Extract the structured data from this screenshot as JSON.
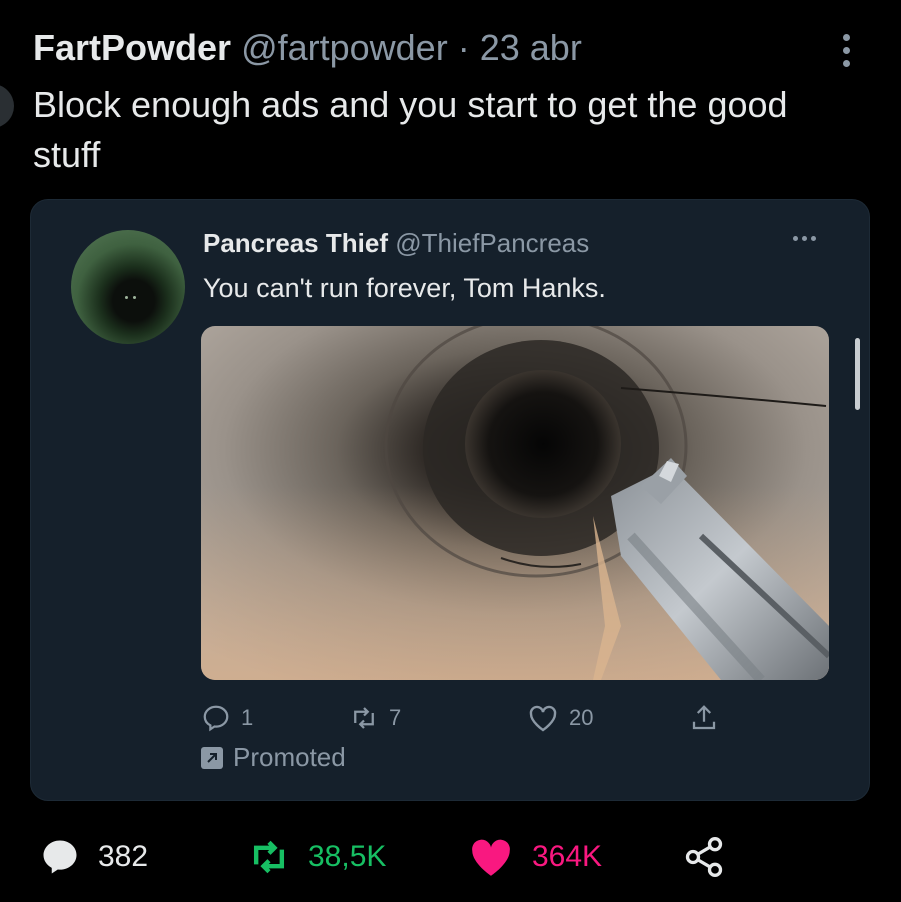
{
  "tweet": {
    "author_name": "FartPowder",
    "author_handle": "@fartpowder",
    "separator": "·",
    "date": "23 abr",
    "text": "Block enough ads and you start to get the good stuff",
    "stats": {
      "replies": "382",
      "retweets": "38,5K",
      "likes": "364K"
    }
  },
  "quoted": {
    "author_name": "Pancreas Thief",
    "author_handle": "@ThiefPancreas",
    "text": "You can't run forever, Tom Hanks.",
    "stats": {
      "replies": "1",
      "retweets": "7",
      "likes": "20"
    },
    "promoted_label": "Promoted"
  },
  "colors": {
    "background": "#000000",
    "card": "#15202b",
    "muted": "#8b98a5",
    "retweet_green": "#17bf63",
    "like_pink": "#f91880"
  },
  "icons": {
    "more": "more-vertical-icon",
    "quoted_more": "more-horizontal-icon",
    "reply": "reply-icon",
    "retweet": "retweet-icon",
    "like": "heart-icon",
    "share": "share-icon",
    "promoted": "promoted-arrow-icon"
  }
}
